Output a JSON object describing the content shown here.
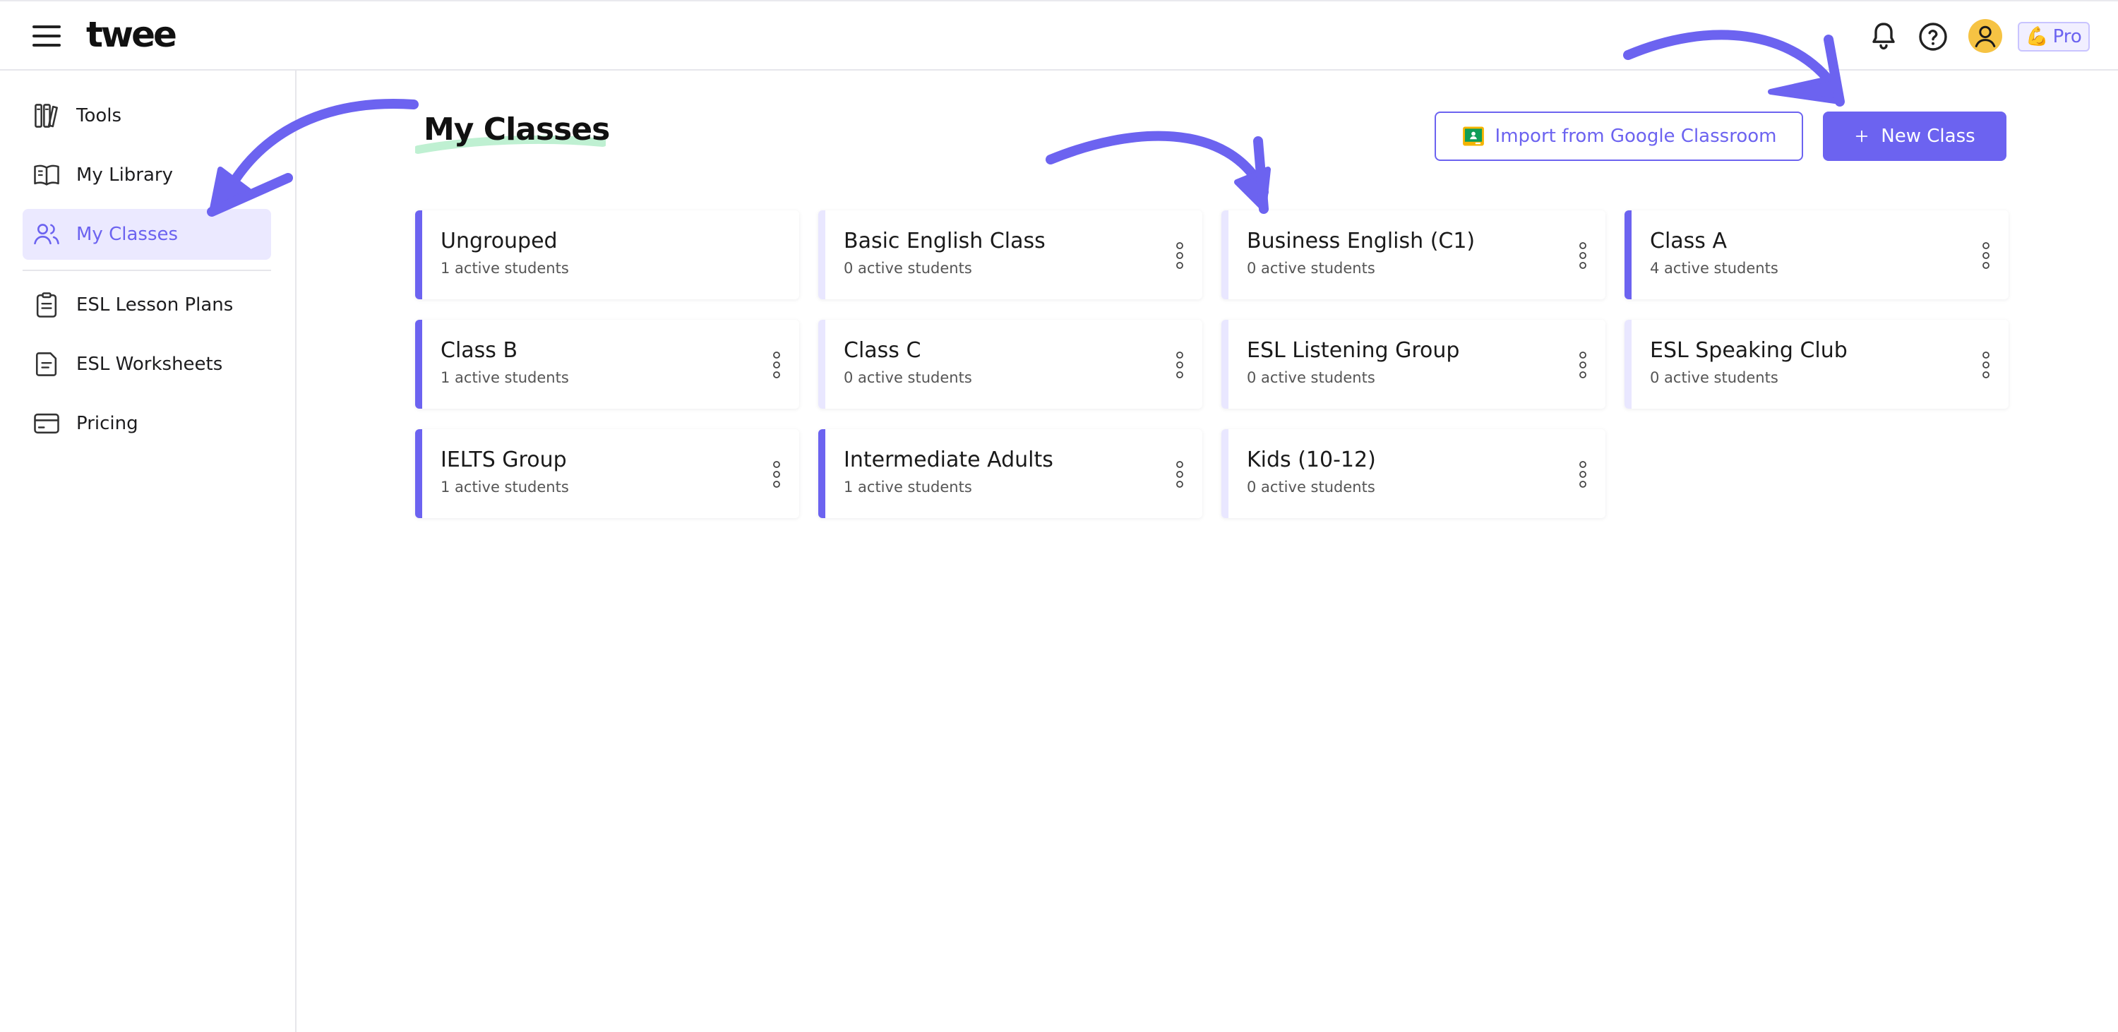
{
  "app": {
    "logo": "twee"
  },
  "header": {
    "icons": [
      "hamburger-menu-icon",
      "bell-icon",
      "help-icon",
      "user-avatar-icon"
    ],
    "pro_badge": {
      "emoji": "💪",
      "label": "Pro"
    }
  },
  "sidebar": {
    "items": [
      {
        "label": "Tools",
        "icon": "tools-icon",
        "active": false
      },
      {
        "label": "My Library",
        "icon": "book-icon",
        "active": false
      },
      {
        "label": "My Classes",
        "icon": "users-icon",
        "active": true
      },
      {
        "label": "ESL Lesson Plans",
        "icon": "clipboard-icon",
        "active": false
      },
      {
        "label": "ESL Worksheets",
        "icon": "worksheet-icon",
        "active": false
      },
      {
        "label": "Pricing",
        "icon": "card-icon",
        "active": false
      }
    ]
  },
  "main": {
    "title": "My Classes",
    "import_button": "Import from Google Classroom",
    "new_class_button": "New Class",
    "classes": [
      {
        "name": "Ungrouped",
        "students": "1 active students"
      },
      {
        "name": "Basic English Class",
        "students": "0 active students"
      },
      {
        "name": "Business English (C1)",
        "students": "0 active students"
      },
      {
        "name": "Class A",
        "students": "4 active students"
      },
      {
        "name": "Class B",
        "students": "1 active students"
      },
      {
        "name": "Class C",
        "students": "0 active students"
      },
      {
        "name": "ESL Listening Group",
        "students": "0 active students"
      },
      {
        "name": "ESL Speaking Club",
        "students": "0 active students"
      },
      {
        "name": "IELTS Group",
        "students": "1 active students"
      },
      {
        "name": "Intermediate Adults",
        "students": "1 active students"
      },
      {
        "name": "Kids (10-12)",
        "students": "0 active students"
      }
    ]
  },
  "colors": {
    "accent": "#6c63f0",
    "accent_light": "#ebe9ff",
    "title_highlight": "#bff0d2",
    "avatar": "#f6c343"
  }
}
